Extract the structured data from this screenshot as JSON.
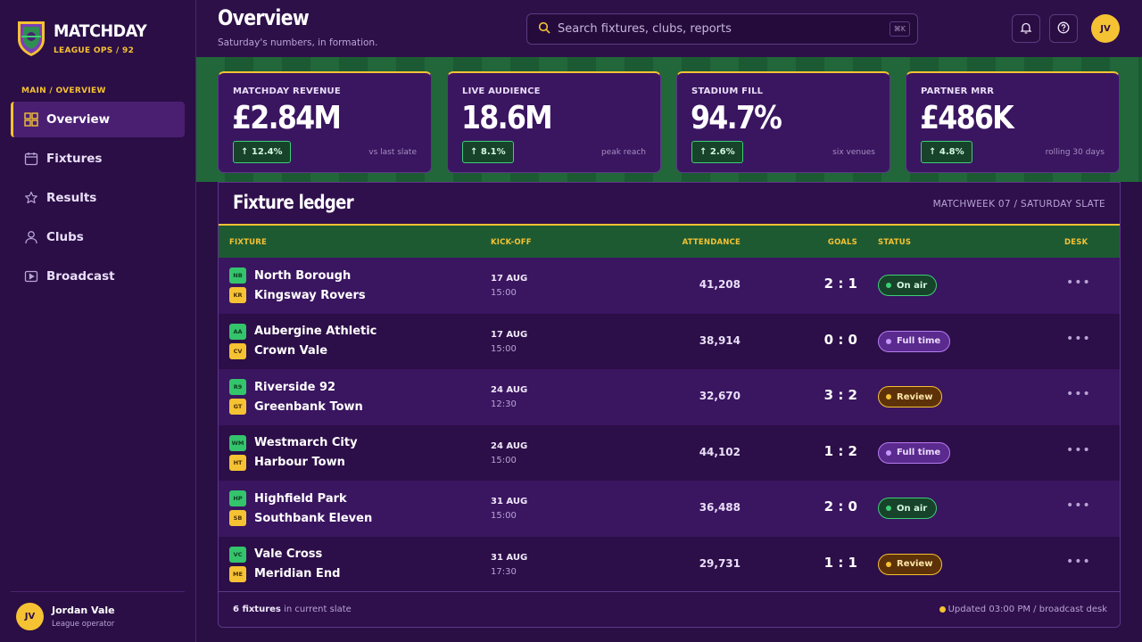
{
  "brand": {
    "name": "MATCHDAY",
    "sub": "LEAGUE OPS / 92"
  },
  "nav": {
    "section": "MAIN / OVERVIEW",
    "items": [
      {
        "label": "Overview",
        "icon": "grid-icon",
        "active": true
      },
      {
        "label": "Fixtures",
        "icon": "calendar-icon"
      },
      {
        "label": "Results",
        "icon": "star-icon"
      },
      {
        "label": "Clubs",
        "icon": "user-icon"
      },
      {
        "label": "Broadcast",
        "icon": "play-icon"
      }
    ]
  },
  "user": {
    "initials": "JV",
    "name": "Jordan Vale",
    "role": "League operator"
  },
  "header": {
    "title": "Overview",
    "subtitle": "Saturday's numbers, in formation.",
    "search_placeholder": "Search fixtures, clubs, reports",
    "search_shortcut": "⌘K",
    "avatar": "JV"
  },
  "kpis": [
    {
      "label": "MATCHDAY REVENUE",
      "value": "£2.84M",
      "delta": "↑ 12.4%",
      "note": "vs last slate"
    },
    {
      "label": "LIVE AUDIENCE",
      "value": "18.6M",
      "delta": "↑ 8.1%",
      "note": "peak reach"
    },
    {
      "label": "STADIUM FILL",
      "value": "94.7%",
      "delta": "↑ 2.6%",
      "note": "six venues"
    },
    {
      "label": "PARTNER MRR",
      "value": "£486K",
      "delta": "↑ 4.8%",
      "note": "rolling 30 days"
    }
  ],
  "ledger": {
    "title": "Fixture ledger",
    "meta": "MATCHWEEK 07 / SATURDAY SLATE",
    "columns": {
      "fixture": "FIXTURE",
      "kickoff": "KICK-OFF",
      "attendance": "ATTENDANCE",
      "goals": "GOALS",
      "status": "STATUS",
      "desk": "DESK"
    },
    "rows": [
      {
        "home_abbr": "NB",
        "home": "North Borough",
        "away_abbr": "KR",
        "away": "Kingsway Rovers",
        "date": "17 AUG",
        "time": "15:00",
        "attendance": "41,208",
        "goals": "2 : 1",
        "status": "On air",
        "status_type": "onair"
      },
      {
        "home_abbr": "AA",
        "home": "Aubergine Athletic",
        "away_abbr": "CV",
        "away": "Crown Vale",
        "date": "17 AUG",
        "time": "15:00",
        "attendance": "38,914",
        "goals": "0 : 0",
        "status": "Full time",
        "status_type": "full"
      },
      {
        "home_abbr": "R9",
        "home": "Riverside 92",
        "away_abbr": "GT",
        "away": "Greenbank Town",
        "date": "24 AUG",
        "time": "12:30",
        "attendance": "32,670",
        "goals": "3 : 2",
        "status": "Review",
        "status_type": "review"
      },
      {
        "home_abbr": "WM",
        "home": "Westmarch City",
        "away_abbr": "HT",
        "away": "Harbour Town",
        "date": "24 AUG",
        "time": "15:00",
        "attendance": "44,102",
        "goals": "1 : 2",
        "status": "Full time",
        "status_type": "full"
      },
      {
        "home_abbr": "HP",
        "home": "Highfield Park",
        "away_abbr": "SB",
        "away": "Southbank Eleven",
        "date": "31 AUG",
        "time": "15:00",
        "attendance": "36,488",
        "goals": "2 : 0",
        "status": "On air",
        "status_type": "onair"
      },
      {
        "home_abbr": "VC",
        "home": "Vale Cross",
        "away_abbr": "ME",
        "away": "Meridian End",
        "date": "31 AUG",
        "time": "17:30",
        "attendance": "29,731",
        "goals": "1 : 1",
        "status": "Review",
        "status_type": "review"
      }
    ],
    "footer_count": "6 fixtures",
    "footer_suffix": "in current slate",
    "footer_updated": "Updated 03:00 PM / broadcast desk"
  },
  "colors": {
    "accent": "#f5c233",
    "pitch": "#21673a",
    "panel": "#3a1560"
  }
}
